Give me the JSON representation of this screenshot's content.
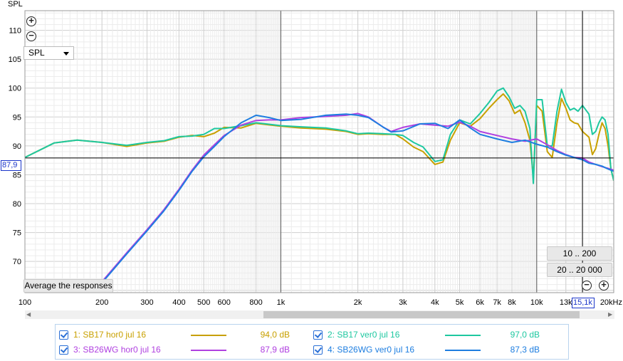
{
  "chart_data": {
    "type": "line",
    "title": "",
    "xlabel": "",
    "ylabel": "SPL",
    "x_scale": "log",
    "xlim": [
      100,
      20000
    ],
    "ylim": [
      65,
      115
    ],
    "x_ticks": [
      100,
      200,
      300,
      400,
      500,
      600,
      800,
      1000,
      2000,
      3000,
      4000,
      5000,
      6000,
      7000,
      8000,
      10000,
      13000,
      20000
    ],
    "x_tick_labels": [
      "100",
      "200",
      "300",
      "400",
      "500",
      "600",
      "800",
      "1k",
      "2k",
      "3k",
      "4k",
      "5k",
      "6k",
      "7k",
      "8k",
      "10k",
      "13k",
      "20kHz"
    ],
    "y_ticks": [
      70,
      75,
      80,
      85,
      90,
      95,
      100,
      105,
      110
    ],
    "y_tick_labels": [
      "70",
      "75",
      "80",
      "85",
      "90",
      "95",
      "100",
      "105",
      "110"
    ],
    "grid": true,
    "cursor": {
      "x": 15100,
      "y": 87.9,
      "x_label": "15,1k",
      "y_label": "87,9"
    },
    "series": [
      {
        "name": "1: SB17 hor0 jul 16",
        "value_label": "94,0 dB",
        "color": "#c8a000",
        "x": [
          100,
          130,
          160,
          200,
          250,
          300,
          350,
          400,
          450,
          500,
          550,
          600,
          700,
          800,
          1000,
          1200,
          1500,
          1800,
          2000,
          2200,
          2500,
          2800,
          3000,
          3300,
          3600,
          4000,
          4300,
          4600,
          5000,
          5500,
          6000,
          6500,
          7000,
          7400,
          7800,
          8200,
          8600,
          9000,
          9400,
          9700,
          10000,
          10500,
          11000,
          11500,
          12000,
          12500,
          13000,
          13500,
          14000,
          14500,
          15100,
          16000,
          16500,
          17000,
          17500,
          18000,
          18500,
          19000,
          19500,
          20000
        ],
        "y": [
          88,
          90.5,
          91.0,
          90.6,
          89.9,
          90.5,
          90.8,
          91.5,
          91.8,
          91.6,
          92.2,
          93.2,
          93.1,
          93.9,
          93.4,
          93.1,
          92.9,
          92.5,
          92.0,
          92.1,
          92.0,
          92.0,
          91.2,
          89.8,
          89.0,
          86.8,
          87.2,
          91.0,
          94.0,
          93.4,
          94.7,
          96.5,
          98.0,
          99.0,
          97.8,
          95.6,
          96.2,
          94.0,
          91.0,
          84.5,
          97.0,
          96.0,
          89.0,
          88.0,
          94.0,
          98.2,
          96.5,
          94.5,
          94.0,
          93.8,
          92.5,
          91.5,
          88.5,
          89.5,
          92.0,
          94.0,
          93.0,
          90.0,
          86.0,
          84.0
        ]
      },
      {
        "name": "2: SB17 ver0 jul 16",
        "value_label": "97,0 dB",
        "color": "#1ec8a0",
        "x": [
          100,
          130,
          160,
          200,
          250,
          300,
          350,
          400,
          450,
          500,
          550,
          600,
          700,
          800,
          1000,
          1200,
          1500,
          1800,
          2000,
          2200,
          2500,
          2800,
          3000,
          3300,
          3600,
          4000,
          4300,
          4600,
          5000,
          5500,
          6000,
          6500,
          7000,
          7400,
          7800,
          8200,
          8600,
          9000,
          9400,
          9700,
          10000,
          10500,
          11000,
          11500,
          12000,
          12500,
          13000,
          13500,
          14000,
          14500,
          15100,
          16000,
          16500,
          17000,
          17500,
          18000,
          18500,
          19000,
          19500,
          20000
        ],
        "y": [
          88,
          90.5,
          91.0,
          90.6,
          90.1,
          90.6,
          90.9,
          91.6,
          91.7,
          92.0,
          93.0,
          93.0,
          93.5,
          94.0,
          93.5,
          93.3,
          93.1,
          92.6,
          92.1,
          92.2,
          92.1,
          92.0,
          91.8,
          90.6,
          89.8,
          87.3,
          87.6,
          92.0,
          94.5,
          93.8,
          95.6,
          97.5,
          99.5,
          100.0,
          98.5,
          96.5,
          97.0,
          96.0,
          93.0,
          83.5,
          98.0,
          98.0,
          90.0,
          90.0,
          96.0,
          99.8,
          97.5,
          96.2,
          96.5,
          96.0,
          97.0,
          95.5,
          92.0,
          92.5,
          94.0,
          95.0,
          94.5,
          92.0,
          86.0,
          84.0
        ]
      },
      {
        "name": "3: SB26WG hor0 jul 16",
        "value_label": "87,9 dB",
        "color": "#b040e0",
        "x": [
          180,
          200,
          250,
          300,
          350,
          400,
          450,
          500,
          550,
          600,
          700,
          800,
          900,
          1000,
          1200,
          1500,
          1800,
          2000,
          2200,
          2500,
          2700,
          3000,
          3500,
          4000,
          4500,
          5000,
          5500,
          6000,
          7000,
          8000,
          9000,
          10000,
          11000,
          12000,
          13000,
          14000,
          15100,
          16000,
          17000,
          18000,
          19000,
          20000
        ],
        "y": [
          63.8,
          66.5,
          71.5,
          75.5,
          79.0,
          82.5,
          85.8,
          88.4,
          90.2,
          91.8,
          93.6,
          94.4,
          94.5,
          94.5,
          94.9,
          95.1,
          95.3,
          95.6,
          95.0,
          93.3,
          92.5,
          93.2,
          93.8,
          93.6,
          93.4,
          94.1,
          93.4,
          92.5,
          91.8,
          91.2,
          90.8,
          91.2,
          90.2,
          89.2,
          88.5,
          88.0,
          87.9,
          87.2,
          86.8,
          86.4,
          86.1,
          85.8
        ]
      },
      {
        "name": "4: SB26WG ver0 jul 16",
        "value_label": "87,3 dB",
        "color": "#1e7ee0",
        "x": [
          180,
          200,
          250,
          300,
          350,
          400,
          450,
          500,
          550,
          600,
          700,
          800,
          900,
          1000,
          1200,
          1500,
          1800,
          2000,
          2200,
          2500,
          2700,
          3000,
          3500,
          4000,
          4500,
          5000,
          5500,
          6000,
          7000,
          8000,
          9000,
          10000,
          11000,
          12000,
          13000,
          14000,
          15100,
          16000,
          17000,
          18000,
          19000,
          20000
        ],
        "y": [
          63.8,
          66.3,
          71.3,
          75.3,
          78.8,
          82.3,
          85.6,
          88.1,
          89.9,
          91.6,
          94.0,
          95.3,
          94.9,
          94.4,
          94.6,
          95.3,
          95.5,
          95.3,
          94.9,
          93.3,
          92.4,
          92.6,
          93.8,
          93.9,
          93.0,
          94.5,
          93.1,
          92.0,
          91.2,
          90.6,
          91.0,
          90.3,
          89.8,
          89.0,
          88.4,
          88.0,
          87.6,
          87.0,
          86.8,
          86.5,
          86.0,
          85.6
        ]
      }
    ]
  },
  "ui": {
    "y_axis_title": "SPL",
    "selector_value": "SPL",
    "average_button": "Average the responses",
    "range_button_y": "10 .. 200",
    "range_button_x": "20 .. 20 000",
    "zoom_in_icon": "zoom-in-icon",
    "zoom_out_icon": "zoom-out-icon"
  }
}
